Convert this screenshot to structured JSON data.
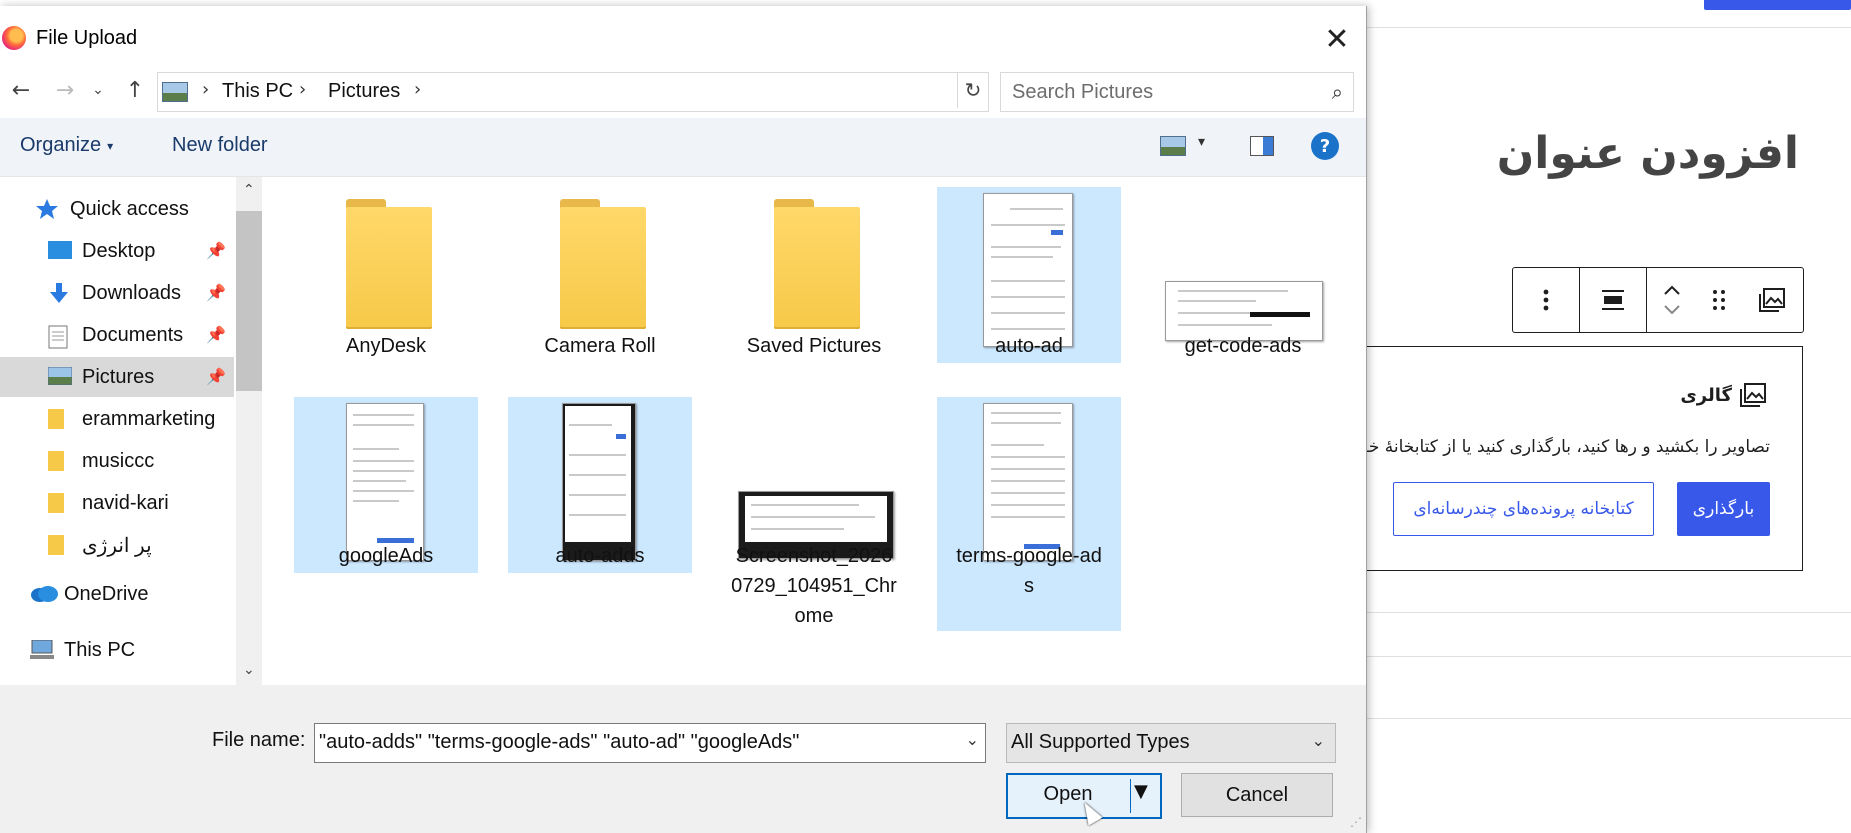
{
  "background": {
    "page_title": "افزودن عنوان",
    "gallery_label": "گالری",
    "gallery_text": "تصاویر را بکشید و رها کنید، بارگذاری کنید یا از کتابخانهٔ خود",
    "upload_button": "بارگذاری",
    "library_button": "کتابخانه پرونده‌های چندرسانه‌ای",
    "accent_color": "#3858e9"
  },
  "dialog": {
    "title": "File Upload",
    "address": {
      "breadcrumbs": [
        "This PC",
        "Pictures"
      ]
    },
    "search": {
      "placeholder": "Search Pictures"
    },
    "toolbar": {
      "organize": "Organize",
      "new_folder": "New folder"
    },
    "nav": [
      {
        "label": "Quick access",
        "icon": "star-icon",
        "pinned": false,
        "selected": false
      },
      {
        "label": "Desktop",
        "icon": "desktop-icon",
        "pinned": true,
        "selected": false
      },
      {
        "label": "Downloads",
        "icon": "download-icon",
        "pinned": true,
        "selected": false
      },
      {
        "label": "Documents",
        "icon": "document-icon",
        "pinned": true,
        "selected": false
      },
      {
        "label": "Pictures",
        "icon": "pictures-icon",
        "pinned": true,
        "selected": true
      },
      {
        "label": "erammarketing",
        "icon": "folder-icon",
        "pinned": false,
        "selected": false
      },
      {
        "label": "musiccc",
        "icon": "folder-icon",
        "pinned": false,
        "selected": false
      },
      {
        "label": "navid-kari",
        "icon": "folder-icon",
        "pinned": false,
        "selected": false
      },
      {
        "label": "پر انرژی",
        "icon": "folder-icon",
        "pinned": false,
        "selected": false
      },
      {
        "label": "OneDrive",
        "icon": "cloud-icon",
        "pinned": false,
        "selected": false
      },
      {
        "label": "This PC",
        "icon": "computer-icon",
        "pinned": false,
        "selected": false
      }
    ],
    "files": [
      {
        "name": "AnyDesk",
        "kind": "folder",
        "selected": false
      },
      {
        "name": "Camera Roll",
        "kind": "folder",
        "selected": false
      },
      {
        "name": "Saved Pictures",
        "kind": "folder",
        "selected": false
      },
      {
        "name": "auto-ad",
        "kind": "image",
        "selected": true
      },
      {
        "name": "get-code-ads",
        "kind": "image",
        "selected": false
      },
      {
        "name": "googleAds",
        "kind": "image",
        "selected": true
      },
      {
        "name": "auto-adds",
        "kind": "image",
        "selected": true
      },
      {
        "name": "Screenshot_2026\n0729_104951_Chr\nome",
        "kind": "image",
        "selected": false
      },
      {
        "name": "terms-google-ad\ns",
        "kind": "image",
        "selected": true
      }
    ],
    "file_name_label": "File name:",
    "file_name_value": "\"auto-adds\" \"terms-google-ads\" \"auto-ad\" \"googleAds\"",
    "file_type": "All Supported Types",
    "open_button": "Open",
    "cancel_button": "Cancel",
    "selection_color": "#cce8ff"
  }
}
